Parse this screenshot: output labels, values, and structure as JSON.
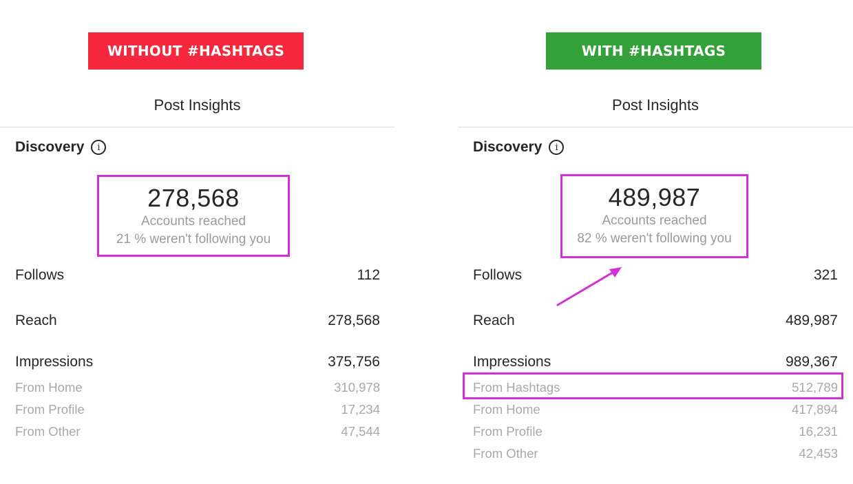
{
  "colors": {
    "without_banner": "#f7283d",
    "with_banner": "#33a03a",
    "highlight": "#d42fd6"
  },
  "left": {
    "banner": "WITHOUT #HASHTAGS",
    "title": "Post Insights",
    "section": "Discovery",
    "section_icon": "info-icon",
    "accounts_reached": "278,568",
    "accounts_reached_label": "Accounts reached",
    "not_following": "21 % weren't following you",
    "metrics": [
      {
        "label": "Follows",
        "value": "112"
      },
      {
        "label": "Reach",
        "value": "278,568"
      },
      {
        "label": "Impressions",
        "value": "375,756"
      }
    ],
    "impression_sources": [
      {
        "label": "From Home",
        "value": "310,978"
      },
      {
        "label": "From Profile",
        "value": "17,234"
      },
      {
        "label": "From Other",
        "value": "47,544"
      }
    ]
  },
  "right": {
    "banner": "WITH #HASHTAGS",
    "title": "Post Insights",
    "section": "Discovery",
    "section_icon": "info-icon",
    "accounts_reached": "489,987",
    "accounts_reached_label": "Accounts reached",
    "not_following": "82 % weren't following you",
    "metrics": [
      {
        "label": "Follows",
        "value": "321"
      },
      {
        "label": "Reach",
        "value": "489,987"
      },
      {
        "label": "Impressions",
        "value": "989,367"
      }
    ],
    "impression_sources": [
      {
        "label": "From Hashtags",
        "value": "512,789"
      },
      {
        "label": "From Home",
        "value": "417,894"
      },
      {
        "label": "From Profile",
        "value": "16,231"
      },
      {
        "label": "From Other",
        "value": "42,453"
      }
    ]
  }
}
